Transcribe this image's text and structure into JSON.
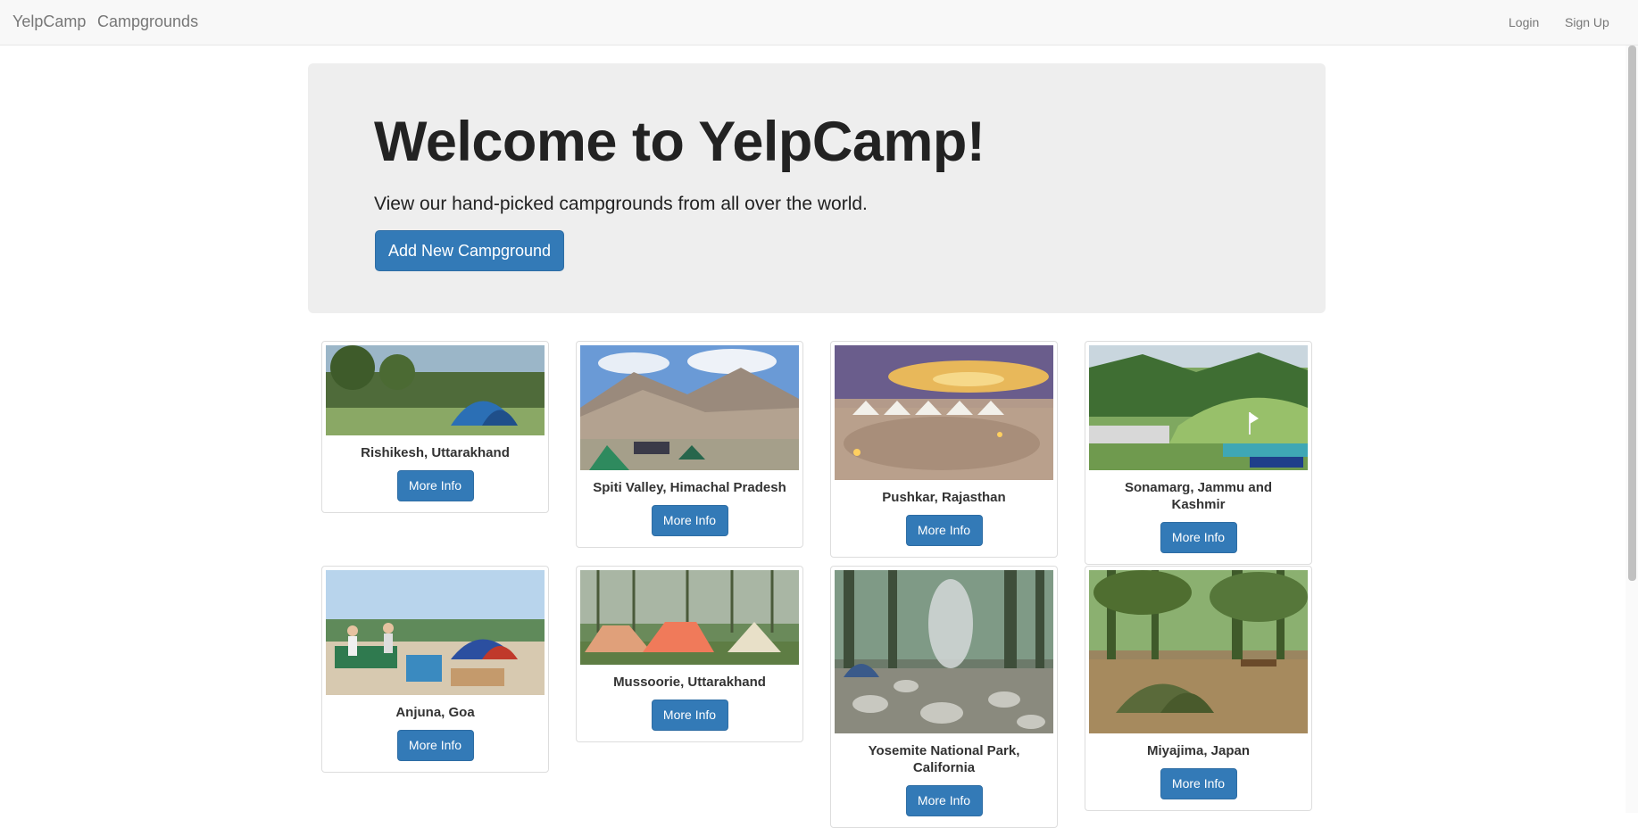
{
  "navbar": {
    "brand": "YelpCamp",
    "links": [
      "Campgrounds"
    ],
    "right": [
      "Login",
      "Sign Up"
    ]
  },
  "jumbotron": {
    "title": "Welcome to YelpCamp!",
    "subtitle": "View our hand-picked campgrounds from all over the world.",
    "button_label": "Add New Campground"
  },
  "campgrounds": [
    {
      "name": "Rishikesh, Uttarakhand",
      "button": "More Info"
    },
    {
      "name": "Spiti Valley, Himachal Pradesh",
      "button": "More Info"
    },
    {
      "name": "Pushkar, Rajasthan",
      "button": "More Info"
    },
    {
      "name": "Sonamarg, Jammu and Kashmir",
      "button": "More Info"
    },
    {
      "name": "Anjuna, Goa",
      "button": "More Info"
    },
    {
      "name": "Mussoorie, Uttarakhand",
      "button": "More Info"
    },
    {
      "name": "Yosemite National Park, California",
      "button": "More Info"
    },
    {
      "name": "Miyajima, Japan",
      "button": "More Info"
    }
  ],
  "colors": {
    "primary": "#337ab7",
    "navbar_bg": "#f8f8f8",
    "jumbotron_bg": "#eeeeee"
  }
}
